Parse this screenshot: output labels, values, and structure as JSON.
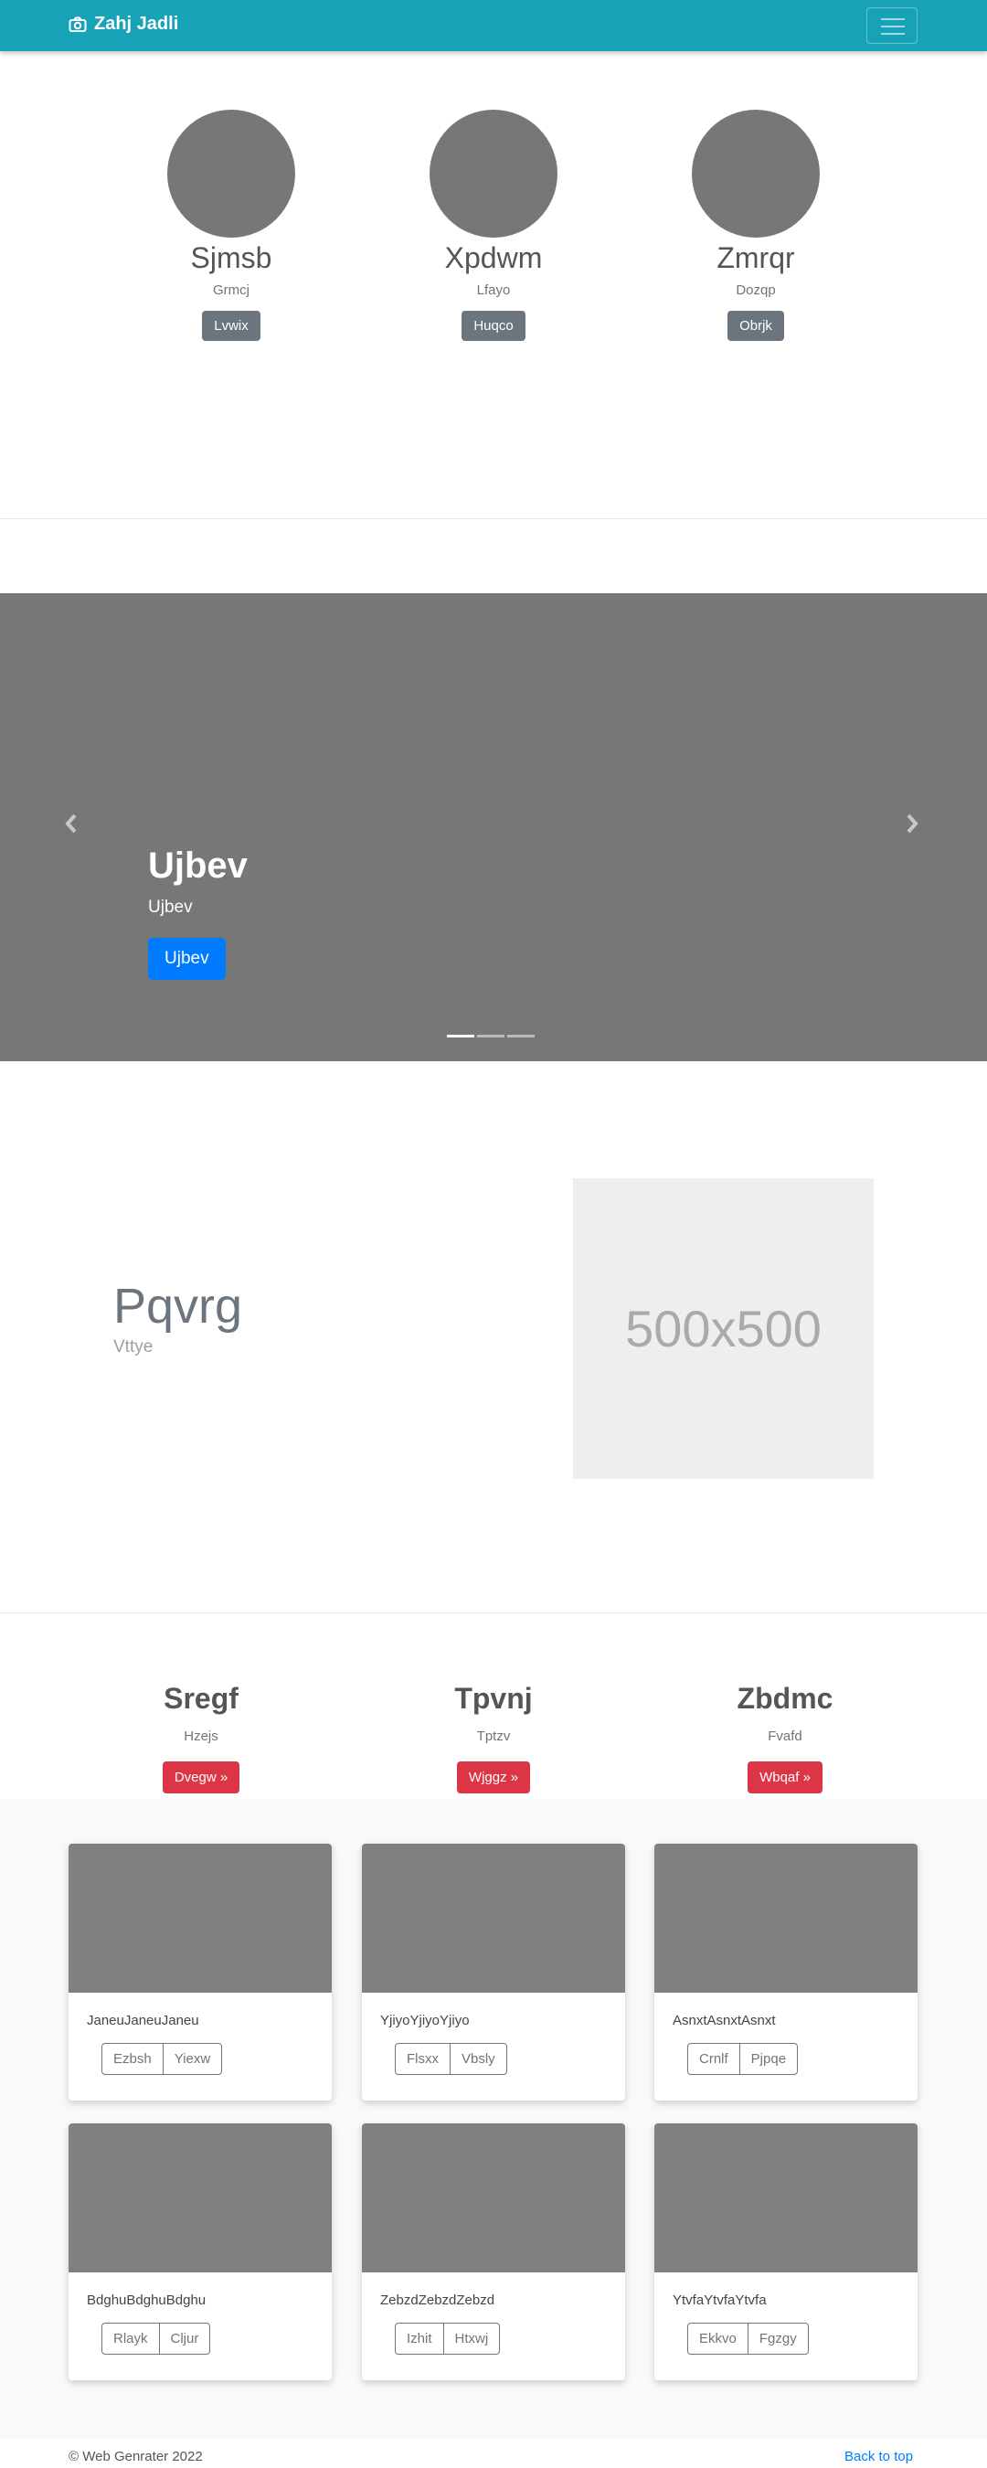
{
  "navbar": {
    "brand": "Zahj Jadli",
    "brand_icon": "camera-icon",
    "toggler_icon": "hamburger-icon"
  },
  "team": [
    {
      "name": "Sjmsb",
      "role": "Grmcj",
      "button": "Lvwix"
    },
    {
      "name": "Xpdwm",
      "role": "Lfayo",
      "button": "Huqco"
    },
    {
      "name": "Zmrqr",
      "role": "Dozqp",
      "button": "Obrjk"
    }
  ],
  "carousel": {
    "title": "Ujbev",
    "text": "Ujbev",
    "button": "Ujbev",
    "prev_icon": "chevron-left-icon",
    "next_icon": "chevron-right-icon",
    "slides": 3,
    "active_slide": 1
  },
  "feature": {
    "title": "Pqvrg",
    "subtitle": "Vttye",
    "image_label": "500x500"
  },
  "columns": [
    {
      "title": "Sregf",
      "subtitle": "Hzejs",
      "button": "Dvegw »"
    },
    {
      "title": "Tpvnj",
      "subtitle": "Tptzv",
      "button": "Wjggz »"
    },
    {
      "title": "Zbdmc",
      "subtitle": "Fvafd",
      "button": "Wbqaf »"
    }
  ],
  "cards": [
    {
      "text": "JaneuJaneuJaneu",
      "btn1": "Ezbsh",
      "btn2": "Yiexw"
    },
    {
      "text": "YjiyoYjiyoYjiyo",
      "btn1": "Flsxx",
      "btn2": "Vbsly"
    },
    {
      "text": "AsnxtAsnxtAsnxt",
      "btn1": "Crnlf",
      "btn2": "Pjpqe"
    },
    {
      "text": "BdghuBdghuBdghu",
      "btn1": "Rlayk",
      "btn2": "Cljur"
    },
    {
      "text": "ZebzdZebzdZebzd",
      "btn1": "Izhit",
      "btn2": "Htxwj"
    },
    {
      "text": "YtvfaYtvfaYtvfa",
      "btn1": "Ekkvo",
      "btn2": "Fgzgy"
    }
  ],
  "footer": {
    "copyright": "© Web Genrater 2022",
    "back_to_top": "Back to top"
  },
  "colors": {
    "navbar": "#17a2b8",
    "primary": "#007bff",
    "danger": "#dc3545",
    "secondary": "#6c757d"
  }
}
